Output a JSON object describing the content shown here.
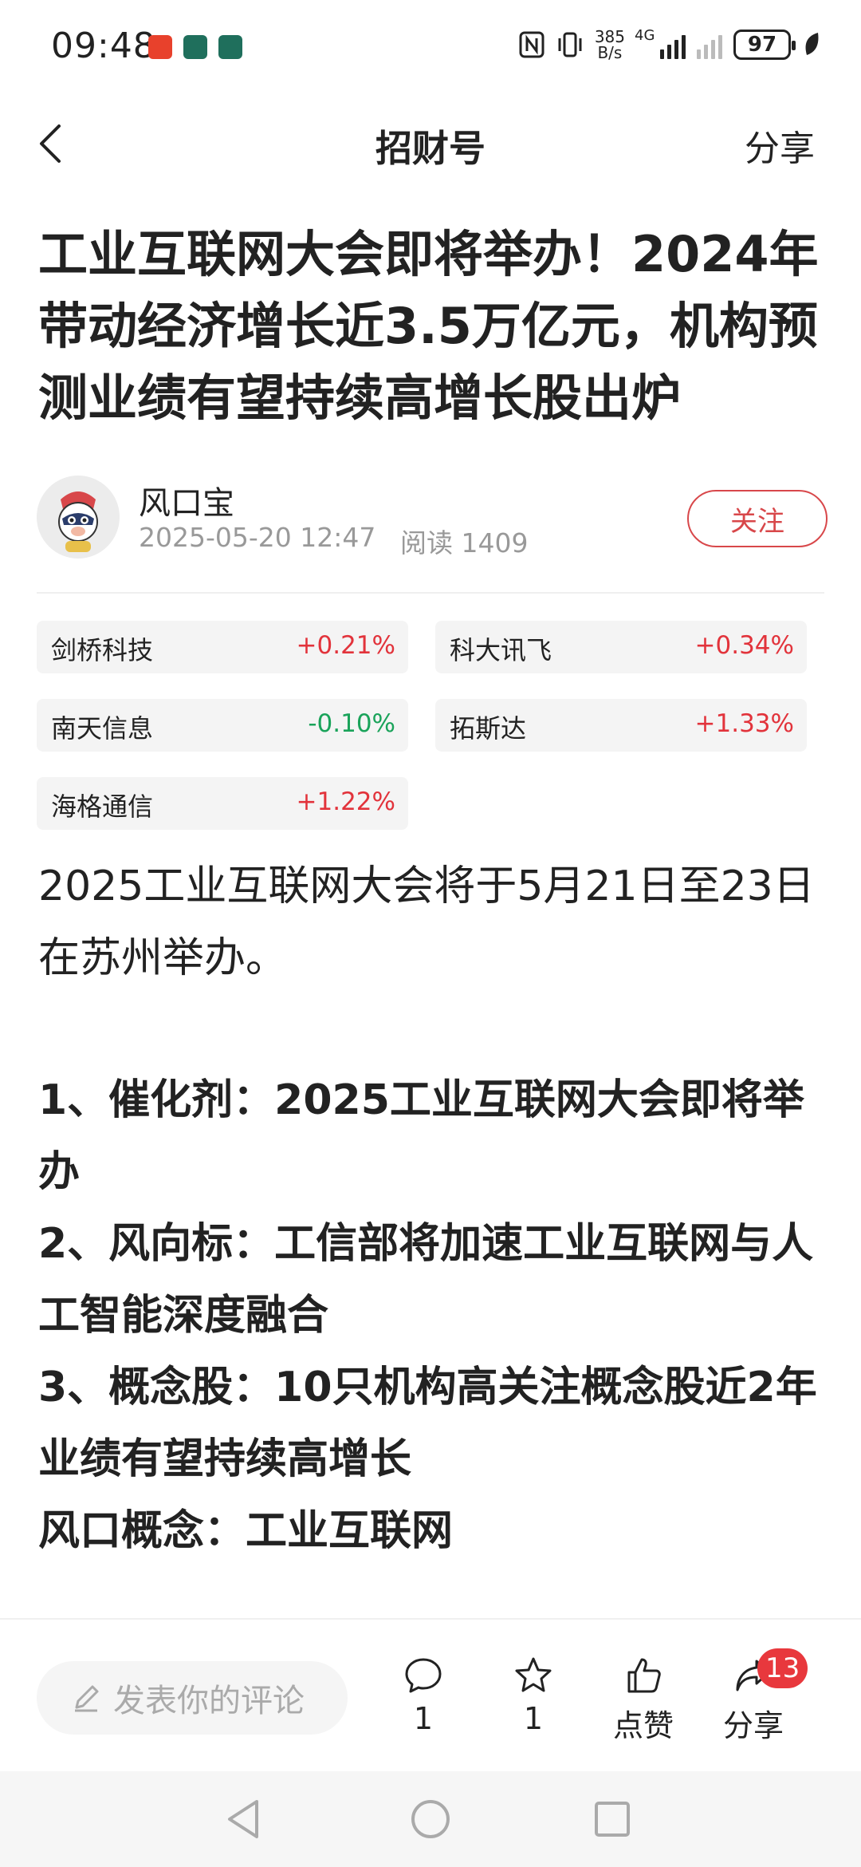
{
  "status_bar": {
    "time": "09:48",
    "net_speed_value": "385",
    "net_speed_unit": "B/s",
    "network_type": "4G",
    "battery": "97",
    "app_icon_colors": [
      "#e8412c",
      "#1f6f5c",
      "#1f6f5c"
    ]
  },
  "header": {
    "title": "招财号",
    "share": "分享"
  },
  "article": {
    "title": "工业互联网大会即将举办！2024年带动经济增长近3.5万亿元，机构预测业绩有望持续高增长股出炉",
    "author": "风口宝",
    "date": "2025-05-20 12:47",
    "read_label": "阅读 1409",
    "follow_label": "关注",
    "stocks": [
      {
        "name": "剑桥科技",
        "change": "+0.21%",
        "direction": "up"
      },
      {
        "name": "科大讯飞",
        "change": "+0.34%",
        "direction": "up"
      },
      {
        "name": "南天信息",
        "change": "-0.10%",
        "direction": "down"
      },
      {
        "name": "拓斯达",
        "change": "+1.33%",
        "direction": "up"
      },
      {
        "name": "海格通信",
        "change": "+1.22%",
        "direction": "up"
      }
    ],
    "intro": "2025工业互联网大会将于5月21日至23日在苏州举办。",
    "points": [
      "1、催化剂：2025工业互联网大会即将举办",
      "2、风向标：工信部将加速工业互联网与人工智能深度融合",
      "3、概念股：10只机构高关注概念股近2年业绩有望持续高增长",
      "风口概念：工业互联网"
    ]
  },
  "bottom_bar": {
    "comment_placeholder": "发表你的评论",
    "comment_count": "1",
    "favorite_count": "1",
    "like_label": "点赞",
    "share_label": "分享",
    "share_badge": "13"
  },
  "colors": {
    "up": "#e2333b",
    "down": "#1aa35a",
    "accent": "#d8474a"
  }
}
